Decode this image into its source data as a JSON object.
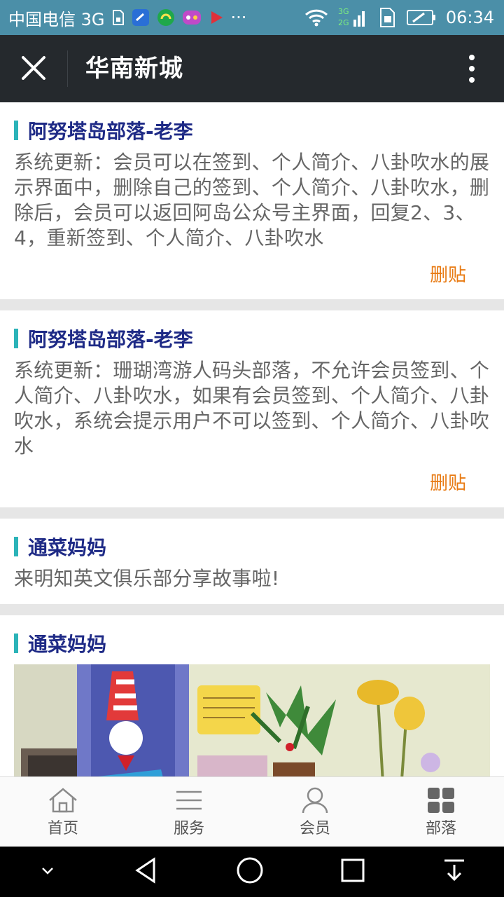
{
  "status_bar": {
    "carrier": "中国电信 3G",
    "network_small": "3G\n2G",
    "more": "···",
    "time": "06:34"
  },
  "header": {
    "title": "华南新城"
  },
  "posts": [
    {
      "author": "阿努塔岛部落-老李",
      "body": "系统更新：会员可以在签到、个人简介、八卦吹水的展示界面中，删除自己的签到、个人简介、八卦吹水，删除后，会员可以返回阿岛公众号主界面，回复2、3、4，重新签到、个人简介、八卦吹水",
      "delete_label": "删贴"
    },
    {
      "author": "阿努塔岛部落-老李",
      "body": "系统更新：珊瑚湾游人码头部落，不允许会员签到、个人简介、八卦吹水，如果有会员签到、个人简介、八卦吹水，系统会提示用户不可以签到、个人简介、八卦吹水",
      "delete_label": "删贴"
    },
    {
      "author": "通菜妈妈",
      "body": "来明知英文俱乐部分享故事啦!"
    },
    {
      "author": "通菜妈妈"
    }
  ],
  "bottom_nav": {
    "items": [
      {
        "label": "首页",
        "icon": "home-icon"
      },
      {
        "label": "服务",
        "icon": "list-icon"
      },
      {
        "label": "会员",
        "icon": "user-icon"
      },
      {
        "label": "部落",
        "icon": "grid-icon"
      }
    ],
    "active_index": 3
  },
  "colors": {
    "status_bar": "#4b8fa8",
    "title_bar": "#25292d",
    "author": "#1e2a86",
    "accent_bar": "#2bb3b8",
    "delete": "#e87a12"
  }
}
